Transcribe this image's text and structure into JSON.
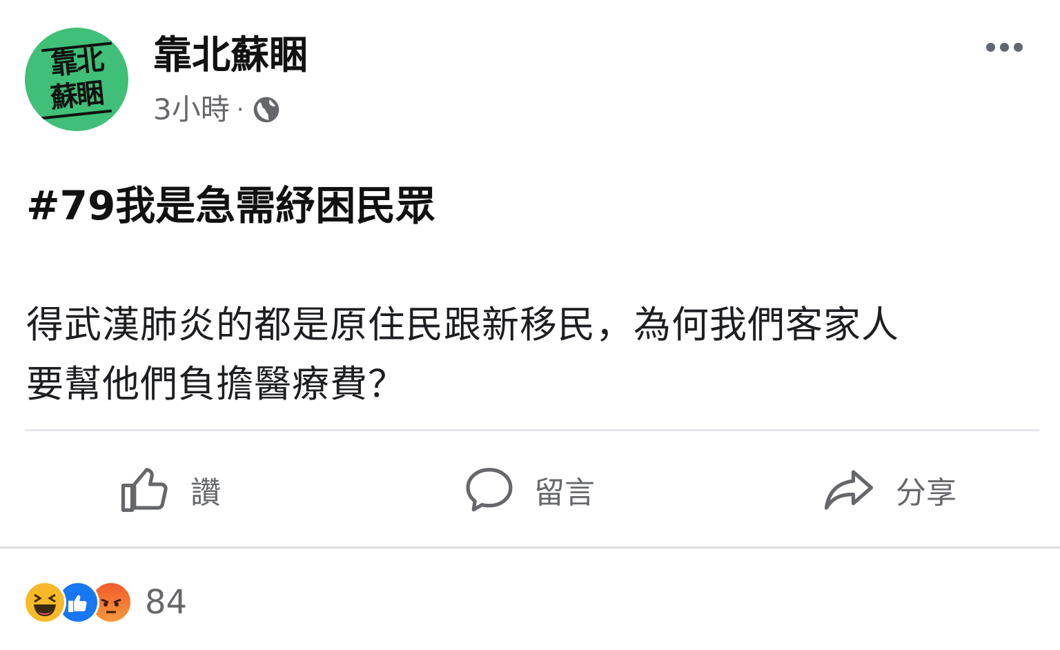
{
  "post": {
    "page_name": "靠北蘇睏",
    "avatar_text_line1": "靠北",
    "avatar_text_line2": "蘇睏",
    "time": "3小時",
    "separator": "·",
    "hashtag": "#79我是急需紓困民眾",
    "body_line1": "得武漢肺炎的都是原住民跟新移民，為何我們客家人",
    "body_line2": "要幫他們負擔醫療費？"
  },
  "actions": {
    "like_label": "讚",
    "comment_label": "留言",
    "share_label": "分享"
  },
  "reactions": {
    "icons": [
      "haha-icon",
      "like-icon",
      "angry-icon"
    ],
    "count": "84"
  },
  "colors": {
    "avatar_green": "#3fbf77",
    "secondary_text": "#65676b",
    "like_blue": "#1877f2"
  }
}
